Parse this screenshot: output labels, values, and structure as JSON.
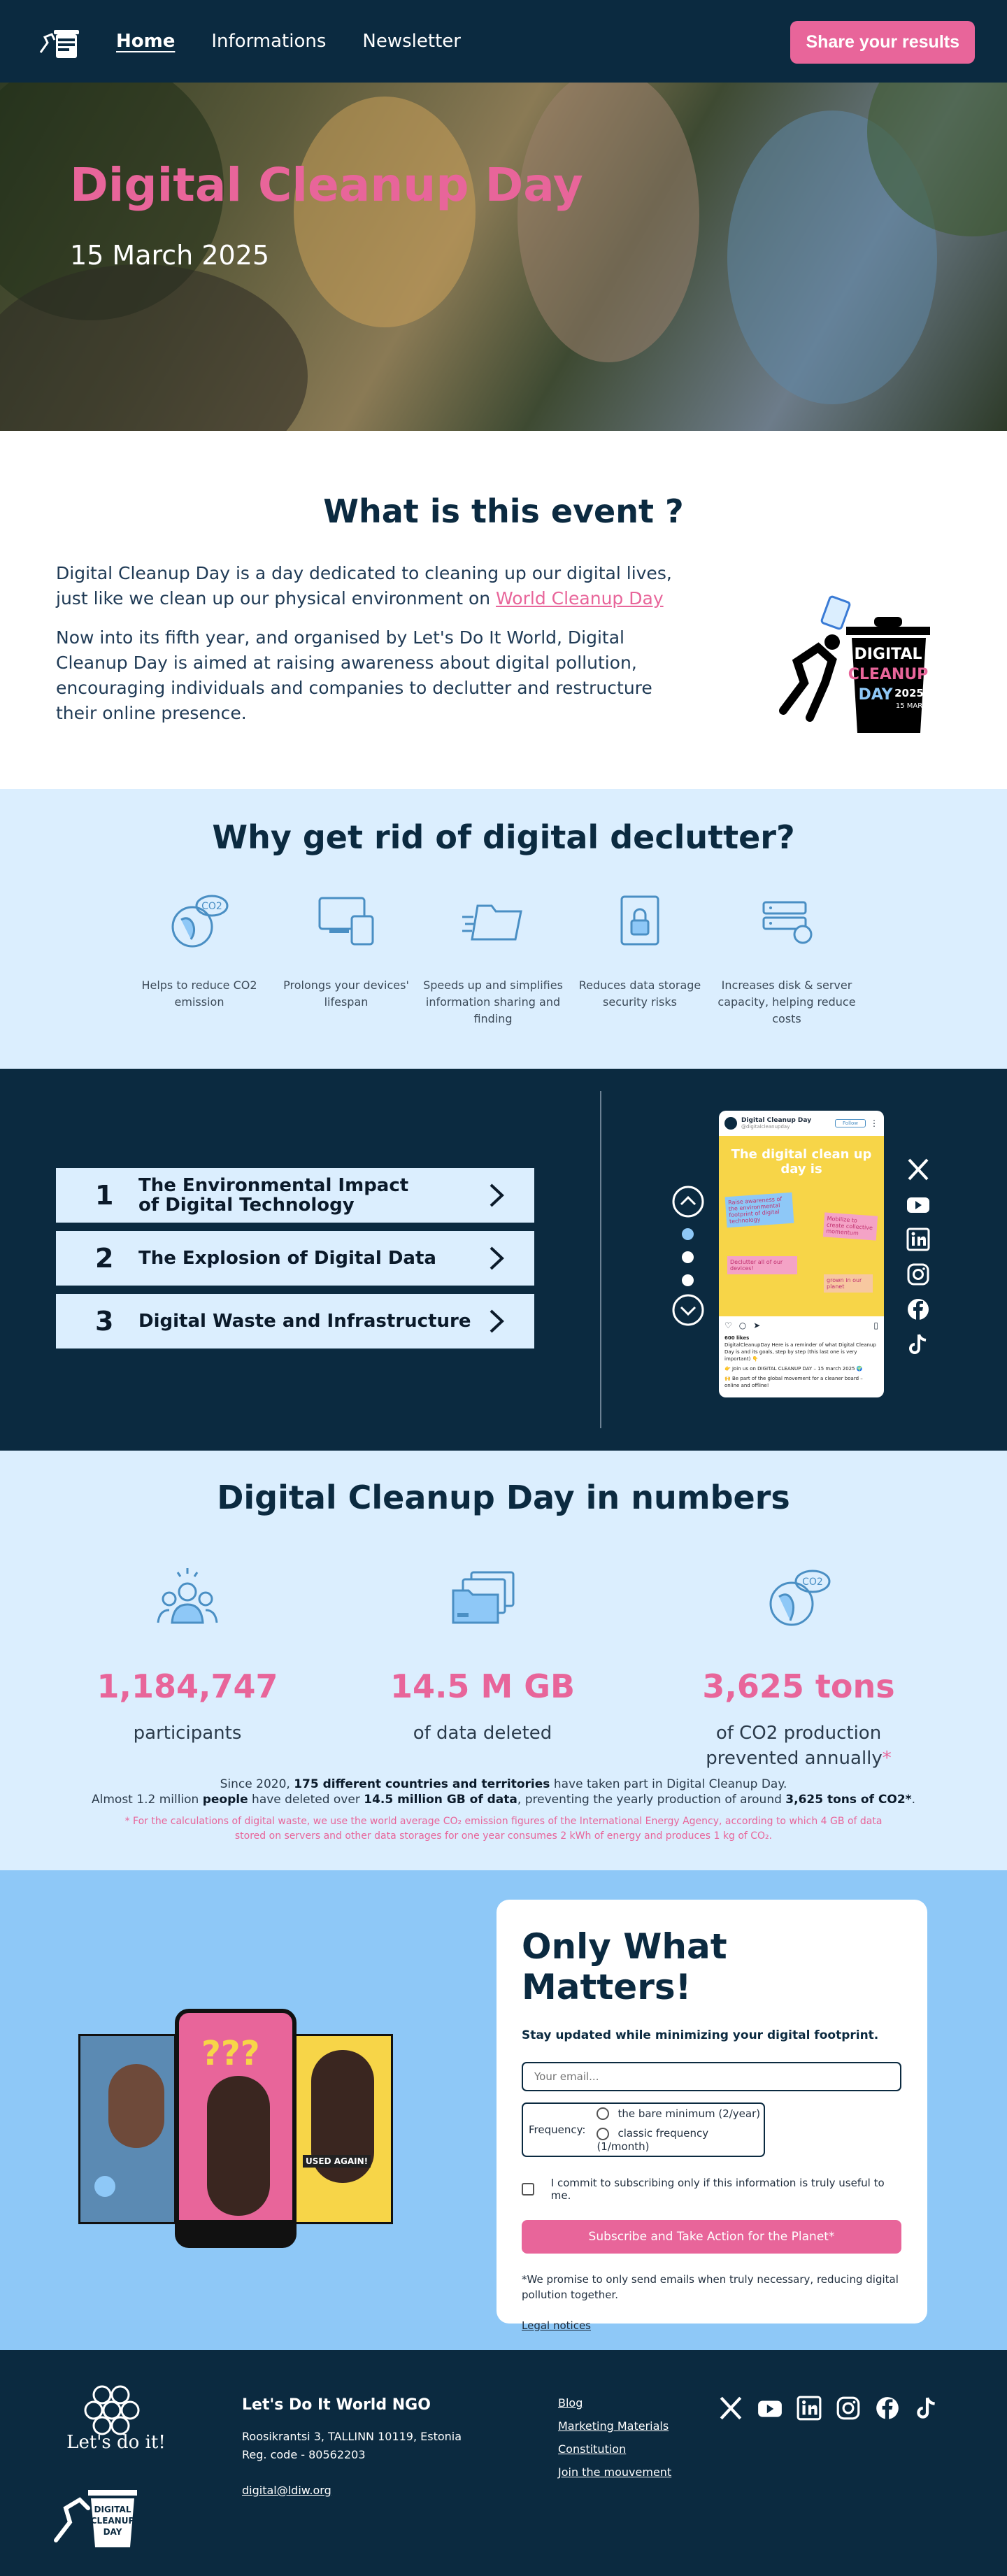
{
  "header": {
    "logo_alt": "Digital Cleanup Day",
    "nav": [
      {
        "label": "Home",
        "active": true
      },
      {
        "label": "Informations",
        "active": false
      },
      {
        "label": "Newsletter",
        "active": false
      }
    ],
    "share_button": "Share your results"
  },
  "hero": {
    "title": "Digital Cleanup Day",
    "date": "15 March 2025"
  },
  "event": {
    "title": "What is this event ?",
    "p1_before_link": "Digital Cleanup Day is a day dedicated to cleaning up our digital lives, just like we clean up our physical environment on ",
    "p1_link": "World Cleanup Day",
    "p2": "Now into its fifth year, and organised by Let's Do It World, Digital Cleanup Day is aimed at raising awareness about digital pollution, encouraging individuals and companies to declutter and restructure their online presence.",
    "logo_lines": [
      "DIGITAL",
      "CLEANUP",
      "DAY",
      "2025",
      "15 MAR"
    ]
  },
  "why": {
    "title": "Why get rid of digital declutter?",
    "items": [
      {
        "icon": "earth-co2-icon",
        "label": "Helps to reduce CO2 emission"
      },
      {
        "icon": "devices-icon",
        "label": "Prolongs your devices' lifespan"
      },
      {
        "icon": "folder-speed-icon",
        "label": "Speeds up and simplifies information sharing and finding"
      },
      {
        "icon": "secure-document-icon",
        "label": "Reduces data storage security risks"
      },
      {
        "icon": "server-icon",
        "label": "Increases disk & server capacity, helping reduce costs"
      }
    ]
  },
  "topics": {
    "items": [
      {
        "num": "1",
        "label": "The Environmental Impact of Digital Technology"
      },
      {
        "num": "2",
        "label": "The Explosion of Digital Data"
      },
      {
        "num": "3",
        "label": "Digital Waste and Infrastructure"
      }
    ],
    "post": {
      "account": "Digital Cleanup Day",
      "handle": "@digitalcleanupday",
      "follow": "Follow",
      "headline": "The digital clean up day is",
      "stickers": [
        "Raise awareness of the environmental footprint of digital technology",
        "Mobilize to create collective momentum",
        "Declutter all of our devices!",
        "grown in our planet"
      ],
      "likes": "600 likes",
      "caption": "DigitalCleanupDay Here is a reminder of what Digital Cleanup Day is and its goals, step by step (this last one is very important) 👇",
      "line2": "👉 Join us on DIGITAL CLEANUP DAY – 15 march 2025 🌍",
      "line3": "🙌 Be part of the global movement for a cleaner board – online and offline!"
    },
    "socials": [
      "x-icon",
      "youtube-icon",
      "linkedin-icon",
      "instagram-icon",
      "facebook-icon",
      "tiktok-icon"
    ]
  },
  "numbers": {
    "title": "Digital Cleanup Day in numbers",
    "stats": [
      {
        "icon": "participants-icon",
        "value": "1,184,747",
        "label": "participants",
        "asterisk": ""
      },
      {
        "icon": "folders-icon",
        "value": "14.5 M GB",
        "label": "of data deleted",
        "asterisk": ""
      },
      {
        "icon": "earth-co2-icon",
        "value": "3,625 tons",
        "label": "of CO2 production prevented annually",
        "asterisk": "*"
      }
    ],
    "summary": {
      "l1_a": "Since 2020, ",
      "l1_b": "175 different countries and territories",
      "l1_c": " have taken part in Digital Cleanup Day.",
      "l2_a": "Almost 1.2 million ",
      "l2_b": "people",
      "l2_c": " have deleted over ",
      "l2_d": "14.5 million GB of data",
      "l2_e": ", preventing the yearly production of around ",
      "l2_f": "3,625 tons of CO2*",
      "l2_g": "."
    },
    "footnote": "* For the calculations of digital waste, we use the world average CO₂ emission figures of the International Energy Agency, according to which 4 GB of data stored on servers and other data storages for one year consumes 2 kWh of energy and produces 1 kg of CO₂."
  },
  "newsletter": {
    "phone_texts": [
      "USED AGAIN!"
    ],
    "title": "Only What Matters!",
    "subtitle": "Stay updated while minimizing your digital footprint.",
    "email_placeholder": "Your email...",
    "frequency_label": "Frequency:",
    "frequency_options": [
      "the bare minimum (2/year)",
      "classic frequency (1/month)"
    ],
    "commit_label": "I commit to subscribing only if this information is truly useful to me.",
    "submit": "Subscribe and Take Action for the Planet*",
    "promise": "*We promise to only send emails when truly necessary, reducing digital pollution together.",
    "legal": "Legal notices"
  },
  "footer": {
    "brand_text": "Let's do it!",
    "brand_logo_lines": [
      "DIGITAL",
      "CLEANUP",
      "DAY"
    ],
    "org_name": "Let's Do It World NGO",
    "address": "Roosikrantsi 3, TALLINN 10119, Estonia",
    "reg": "Reg. code - 80562203",
    "email": "digital@ldiw.org",
    "links": [
      "Blog",
      "Marketing Materials",
      "Constitution",
      "Join the mouvement"
    ],
    "socials": [
      "x-icon",
      "youtube-icon",
      "linkedin-icon",
      "instagram-icon",
      "facebook-icon",
      "tiktok-icon"
    ]
  },
  "colors": {
    "navy": "#0b2a40",
    "pink": "#e8659a",
    "light_blue": "#dbeefe",
    "sky": "#8ec8f7"
  }
}
